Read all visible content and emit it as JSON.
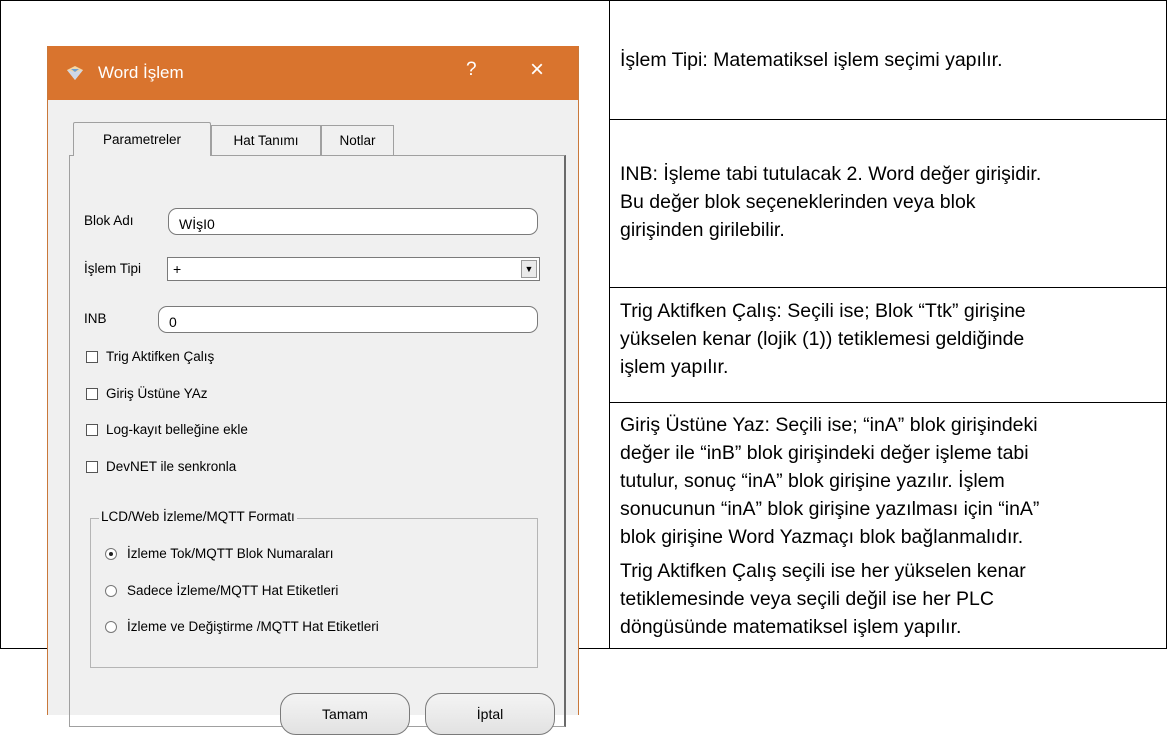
{
  "dialog": {
    "title": "Word İşlem",
    "help_label": "?",
    "close_label": "×",
    "tabs": [
      {
        "label": "Parametreler"
      },
      {
        "label": "Hat Tanımı"
      },
      {
        "label": "Notlar"
      }
    ],
    "block_name": {
      "label": "Blok Adı",
      "value": "WİşI0"
    },
    "op_type": {
      "label": "İşlem Tipi",
      "value": "+"
    },
    "inb": {
      "label": "INB",
      "value": "0"
    },
    "checkboxes": [
      {
        "label": "Trig Aktifken Çalış",
        "checked": false
      },
      {
        "label": "Giriş Üstüne YAz",
        "checked": false
      },
      {
        "label": "Log-kayıt belleğine ekle",
        "checked": false
      },
      {
        "label": "DevNET ile senkronla",
        "checked": false
      }
    ],
    "format_group": {
      "legend": "LCD/Web İzleme/MQTT Formatı",
      "options": [
        {
          "label": "İzleme Tok/MQTT Blok Numaraları",
          "selected": true
        },
        {
          "label": "Sadece İzleme/MQTT Hat Etiketleri",
          "selected": false
        },
        {
          "label": "İzleme ve Değiştirme /MQTT Hat Etiketleri",
          "selected": false
        }
      ]
    },
    "ok_label": "Tamam",
    "cancel_label": "İptal",
    "title_color": "#d9742e"
  },
  "descriptions": [
    {
      "lines": [
        "İşlem Tipi:  Matematiksel işlem seçimi yapılır."
      ]
    },
    {
      "lines": [
        "INB:  İşleme tabi tutulacak 2. Word değer girişidir.",
        "Bu değer blok seçeneklerinden veya blok",
        "girişinden girilebilir."
      ]
    },
    {
      "lines": [
        "Trig Aktifken Çalış:  Seçili ise; Blok “Ttk” girişine",
        "yükselen kenar (lojik (1)) tetiklemesi geldiğinde",
        "işlem yapılır."
      ]
    },
    {
      "lines": [
        "Giriş Üstüne Yaz:  Seçili ise; “inA” blok girişindeki",
        "değer ile “inB” blok girişindeki değer işleme tabi",
        "tutulur, sonuç “inA” blok girişine yazılır. İşlem",
        "sonucunun “inA” blok girişine yazılması için “inA”",
        "blok girişine Word Yazmaçı blok bağlanmalıdır."
      ],
      "extra": [
        "Trig Aktifken Çalış seçili ise her yükselen kenar",
        "tetiklemesinde veya seçili değil ise her PLC",
        "döngüsünde matematiksel işlem yapılır."
      ]
    }
  ]
}
